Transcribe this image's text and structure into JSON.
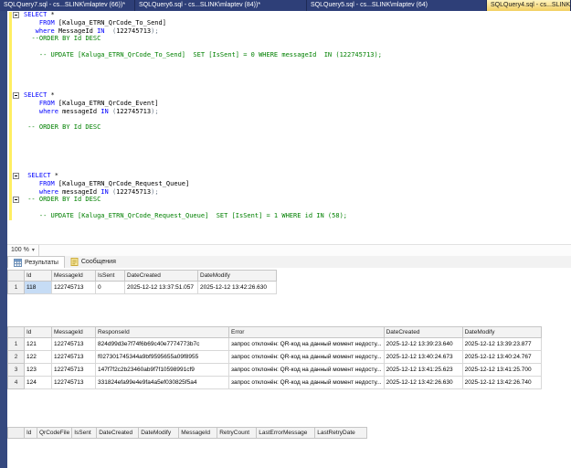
{
  "document_tabs": [
    {
      "label": "SQLQuery7.sql - cs...SLINK\\mlaptev (66))*",
      "active": false
    },
    {
      "label": "SQLQuery6.sql - cs...SLINK\\mlaptev (84))*",
      "active": false
    },
    {
      "label": "SQLQuery5.sql - cs...SLINK\\mlaptev (64)",
      "active": false
    },
    {
      "label": "SQLQuery4.sql - cs...SLINK\\mlaptev (7...",
      "active": true
    }
  ],
  "editor": {
    "zoom_label": "100 %",
    "lines": [
      {
        "fold": true,
        "parts": [
          [
            "k",
            "SELECT"
          ],
          [
            "t",
            " *"
          ]
        ]
      },
      {
        "parts": [
          [
            "t",
            "    "
          ],
          [
            "k",
            "FROM"
          ],
          [
            "t",
            " [Kaluga_ETRN_QrCode_To_Send]"
          ]
        ]
      },
      {
        "parts": [
          [
            "t",
            "   "
          ],
          [
            "k",
            "where"
          ],
          [
            "t",
            " MessageId "
          ],
          [
            "k",
            "IN"
          ],
          [
            "g",
            "  ("
          ],
          [
            "t",
            "122745713"
          ],
          [
            "g",
            ");"
          ]
        ]
      },
      {
        "parts": [
          [
            "t",
            "  "
          ],
          [
            "c",
            "--ORDER BY Id DESC"
          ]
        ]
      },
      {
        "parts": []
      },
      {
        "parts": [
          [
            "t",
            "    "
          ],
          [
            "c",
            "-- UPDATE [Kaluga_ETRN_QrCode_To_Send]  SET [IsSent] = 0 WHERE messageId  IN (122745713);"
          ]
        ]
      },
      {
        "parts": []
      },
      {
        "parts": []
      },
      {
        "parts": []
      },
      {
        "parts": []
      },
      {
        "fold": true,
        "parts": [
          [
            "k",
            "SELECT"
          ],
          [
            "t",
            " *"
          ]
        ]
      },
      {
        "parts": [
          [
            "t",
            "    "
          ],
          [
            "k",
            "FROM"
          ],
          [
            "t",
            " [Kaluga_ETRN_QrCode_Event]"
          ]
        ]
      },
      {
        "parts": [
          [
            "t",
            "    "
          ],
          [
            "k",
            "where"
          ],
          [
            "t",
            " messageId "
          ],
          [
            "k",
            "IN"
          ],
          [
            "g",
            " ("
          ],
          [
            "t",
            "122745713"
          ],
          [
            "g",
            ");"
          ]
        ]
      },
      {
        "parts": []
      },
      {
        "parts": [
          [
            "t",
            " "
          ],
          [
            "c",
            "-- ORDER BY Id DESC"
          ]
        ]
      },
      {
        "parts": []
      },
      {
        "parts": []
      },
      {
        "parts": []
      },
      {
        "parts": []
      },
      {
        "parts": []
      },
      {
        "fold": true,
        "parts": [
          [
            "t",
            " "
          ],
          [
            "k",
            "SELECT"
          ],
          [
            "t",
            " *"
          ]
        ]
      },
      {
        "parts": [
          [
            "t",
            "    "
          ],
          [
            "k",
            "FROM"
          ],
          [
            "t",
            " [Kaluga_ETRN_QrCode_Request_Queue]"
          ]
        ]
      },
      {
        "parts": [
          [
            "t",
            "    "
          ],
          [
            "k",
            "where"
          ],
          [
            "t",
            " messageId "
          ],
          [
            "k",
            "IN"
          ],
          [
            "g",
            " ("
          ],
          [
            "t",
            "122745713"
          ],
          [
            "g",
            ");"
          ]
        ]
      },
      {
        "fold": true,
        "parts": [
          [
            "t",
            " "
          ],
          [
            "c",
            "-- ORDER BY Id DESC"
          ]
        ]
      },
      {
        "parts": []
      },
      {
        "parts": [
          [
            "t",
            "    "
          ],
          [
            "c",
            "-- UPDATE [Kaluga_ETRN_QrCode_Request_Queue]  SET [IsSent] = 1 WHERE id IN (58);"
          ]
        ]
      }
    ]
  },
  "results_pane": {
    "tabs": [
      {
        "label": "Результаты",
        "icon": "results-grid-icon",
        "active": true
      },
      {
        "label": "Сообщения",
        "icon": "messages-icon",
        "active": false
      }
    ],
    "grids": [
      {
        "columns": [
          "Id",
          "MessageId",
          "IsSent",
          "DateCreated",
          "DateModify"
        ],
        "rows": [
          [
            "118",
            "122745713",
            "0",
            "2025-12-12 13:37:51.057",
            "2025-12-12 13:42:26.630"
          ]
        ],
        "selected_cell": {
          "row": 0,
          "col": 0
        }
      },
      {
        "columns": [
          "Id",
          "MessageId",
          "ResponseId",
          "Error",
          "DateCreated",
          "DateModify"
        ],
        "rows": [
          [
            "121",
            "122745713",
            "824d99d3e7f74f6b69c40e7774773b7c",
            "запрос отклонён: QR-код на данный момент недосту...",
            "2025-12-12 13:39:23.640",
            "2025-12-12 13:39:23.877"
          ],
          [
            "122",
            "122745713",
            "f027301745344a9bf9595655a09f8955",
            "запрос отклонён: QR-код на данный момент недосту...",
            "2025-12-12 13:40:24.673",
            "2025-12-12 13:40:24.767"
          ],
          [
            "123",
            "122745713",
            "147f7f2c2b23460ab9f7f10598991cf9",
            "запрос отклонён: QR-код на данный момент недосту...",
            "2025-12-12 13:41:25.623",
            "2025-12-12 13:41:25.700"
          ],
          [
            "124",
            "122745713",
            "331824efa99e4e9fa4a5ef030825f5a4",
            "запрос отклонён: QR-код на данный момент недосту...",
            "2025-12-12 13:42:26.630",
            "2025-12-12 13:42:26.740"
          ]
        ]
      },
      {
        "columns": [
          "Id",
          "QrCodeFile",
          "IsSent",
          "DateCreated",
          "DateModify",
          "MessageId",
          "RetryCount",
          "LastErrorMessage",
          "LastRetryDate"
        ],
        "rows": []
      }
    ]
  },
  "icons": {
    "dropdown_arrow": "▾"
  },
  "colors": {
    "tab_bar": "#2e3f78",
    "active_tab": "#f3cf62",
    "keyword": "#0000ff",
    "comment": "#008000",
    "change_bar": "#ffee62",
    "selected_cell": "#c6dcf5"
  }
}
